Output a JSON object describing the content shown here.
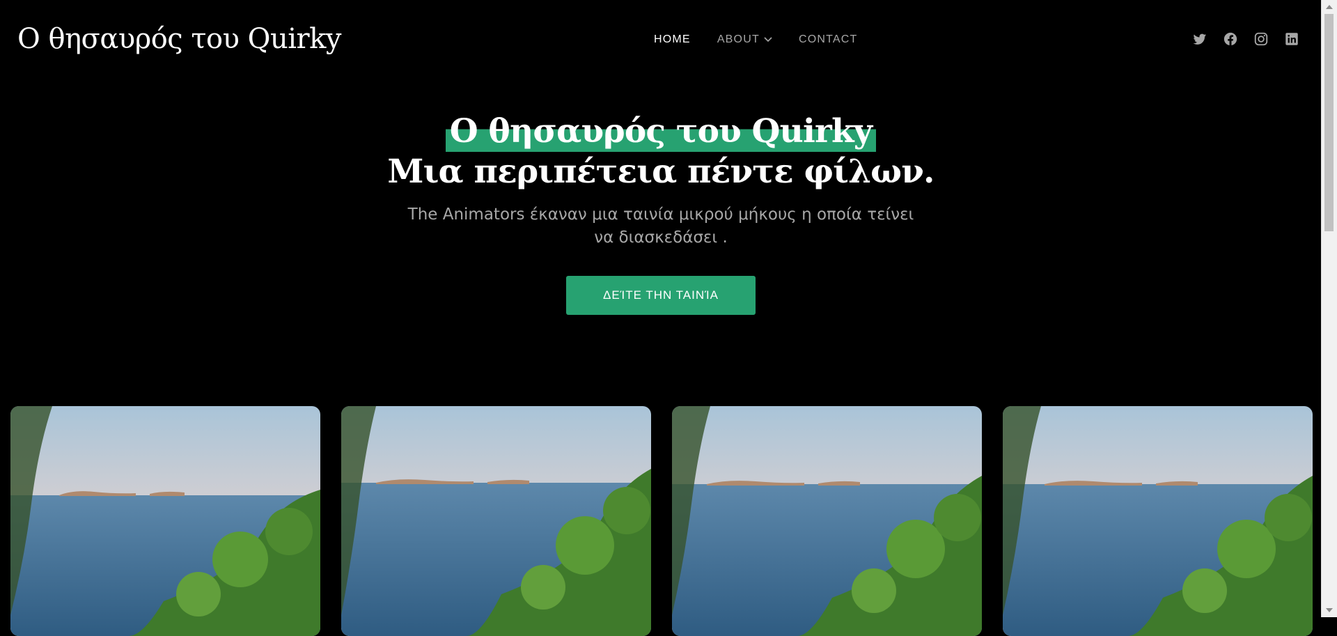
{
  "header": {
    "site_title": "Ο θησαυρός του Quirky",
    "nav": [
      {
        "label": "HOME",
        "active": true,
        "has_dropdown": false
      },
      {
        "label": "ABOUT",
        "active": false,
        "has_dropdown": true
      },
      {
        "label": "CONTACT",
        "active": false,
        "has_dropdown": false
      }
    ],
    "social_icons": [
      "twitter-icon",
      "facebook-icon",
      "instagram-icon",
      "linkedin-icon"
    ]
  },
  "hero": {
    "title_line1": "Ο θησαυρός του Quirky",
    "title_line2": "Μια περιπέτεια πέντε φίλων.",
    "subtitle": "The Animators έκαναν μια ταινία μικρού μήκους η οποία τείνει να διασκεδάσει .",
    "cta_label": "ΔΕΊΤΕ ΤΗΝ ΤΑΙΝΊΑ"
  },
  "gallery": {
    "image_count": 4,
    "subject": "sea view with islands on the horizon framed by green foliage"
  },
  "colors": {
    "background": "#000000",
    "accent": "#27a271",
    "muted_text": "#a7a7a7",
    "text": "#ffffff"
  }
}
